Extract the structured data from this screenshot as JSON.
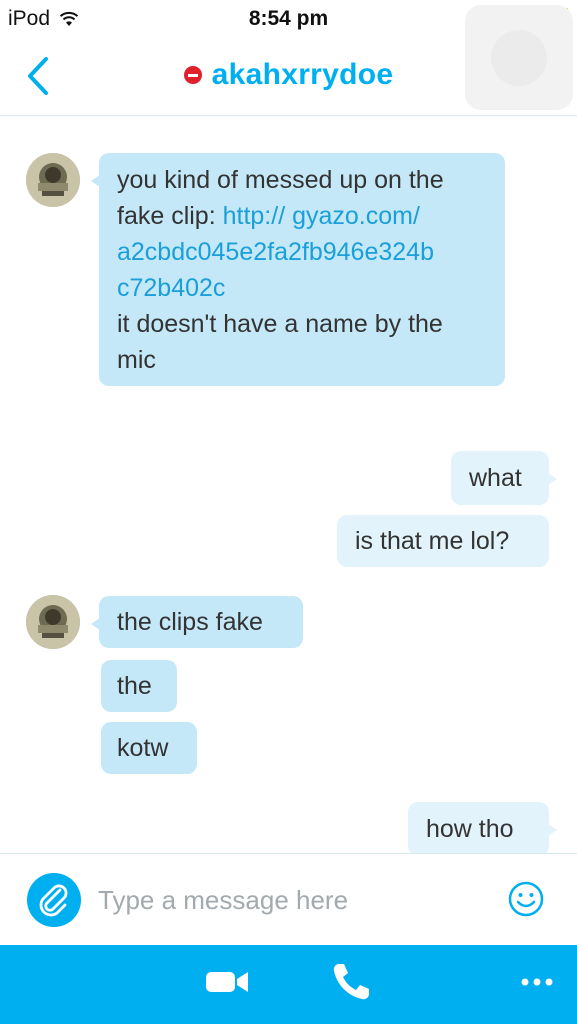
{
  "status_bar": {
    "carrier": "iPod",
    "time": "8:54 pm"
  },
  "header": {
    "contact_name": "akahxrrydoe"
  },
  "messages": [
    {
      "direction": "incoming",
      "lines_before": "you kind of messed up on the fake clip: ",
      "link": "http:// gyazo.com/ a2cbdc045e2fa2fb946e324b c72b402c",
      "lines_after": "it doesn't have a name by the mic"
    },
    {
      "direction": "outgoing",
      "text": "what"
    },
    {
      "direction": "outgoing",
      "text": "is that me lol?"
    },
    {
      "direction": "incoming",
      "text": "the clips fake"
    },
    {
      "direction": "incoming",
      "text": "the"
    },
    {
      "direction": "incoming",
      "text": "kotw"
    },
    {
      "direction": "outgoing",
      "text": "how tho"
    }
  ],
  "composer": {
    "placeholder": "Type a message here"
  },
  "bottom_bar": {
    "items": [
      "video-call",
      "audio-call",
      "more"
    ]
  },
  "colors": {
    "accent": "#00aff0",
    "incoming_bubble": "#c4e8f8",
    "outgoing_bubble": "#e3f3fb",
    "link": "#1a9fd8",
    "presence_dnd": "#e0202a",
    "battery": "#4cd964"
  }
}
